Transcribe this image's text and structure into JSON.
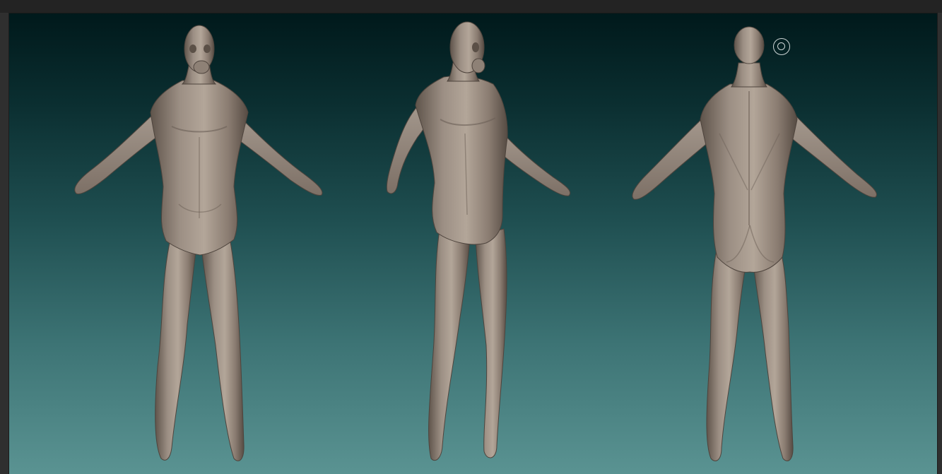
{
  "app": {
    "accent_color": "#8a7c71",
    "viewport_background_top": "#00191b",
    "viewport_background_bottom": "#5a9392"
  },
  "canvas": {
    "models": [
      {
        "view": "front"
      },
      {
        "view": "three-quarter"
      },
      {
        "view": "back"
      }
    ],
    "cursor_icon": "brush-circle-icon"
  }
}
